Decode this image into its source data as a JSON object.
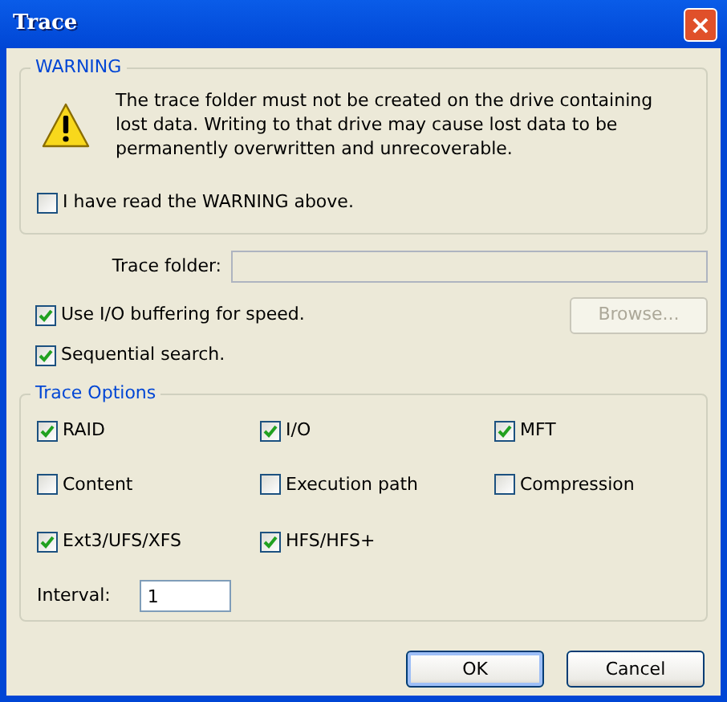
{
  "window": {
    "title": "Trace",
    "close": "×"
  },
  "warning": {
    "legend": "WARNING",
    "text": "The trace folder must not be created on the drive containing lost data. Writing to that drive may cause lost data to be permanently overwritten and unrecoverable.",
    "acknowledge": {
      "label": "I have read the WARNING above.",
      "checked": false
    }
  },
  "trace_folder": {
    "label": "Trace folder:",
    "disabled": true
  },
  "browse": {
    "label": "Browse...",
    "disabled": true
  },
  "options": [
    {
      "label": "Use I/O buffering for speed.",
      "checked": true
    },
    {
      "label": "Sequential search.",
      "checked": true
    }
  ],
  "trace_options": {
    "legend": "Trace Options",
    "items": [
      {
        "label": "RAID",
        "checked": true
      },
      {
        "label": "I/O",
        "checked": true
      },
      {
        "label": "MFT",
        "checked": true
      },
      {
        "label": "Content",
        "checked": false
      },
      {
        "label": "Execution path",
        "checked": false
      },
      {
        "label": "Compression",
        "checked": false
      },
      {
        "label": "Ext3/UFS/XFS",
        "checked": true
      },
      {
        "label": "HFS/HFS+",
        "checked": true
      }
    ],
    "interval": {
      "label": "Interval:",
      "value": "1"
    }
  },
  "buttons": [
    {
      "label": "OK",
      "default": true
    },
    {
      "label": "Cancel",
      "default": false
    }
  ]
}
